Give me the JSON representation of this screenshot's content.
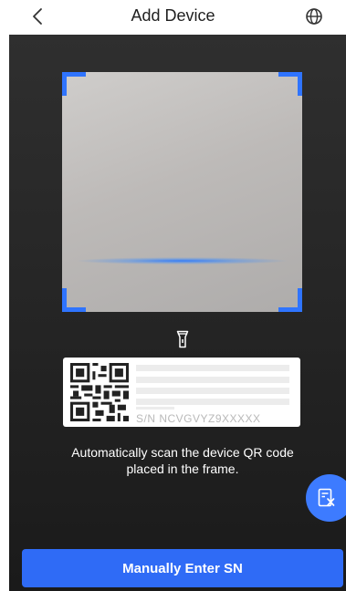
{
  "header": {
    "title": "Add Device",
    "back_icon": "chevron-left-icon",
    "language_icon": "globe-icon"
  },
  "scanner": {
    "flashlight_icon": "flashlight-icon",
    "sample_label": {
      "sn_text": "S/N  NCVGVYZ9XXXXX"
    },
    "instruction": "Automatically scan the device QR code placed in the frame."
  },
  "side_button": {
    "icon": "document-scan-icon"
  },
  "footer": {
    "manual_button_label": "Manually Enter SN"
  },
  "colors": {
    "accent": "#2f6bf6",
    "frame_corner": "#2f74ff",
    "camera_bg": "#262626"
  }
}
